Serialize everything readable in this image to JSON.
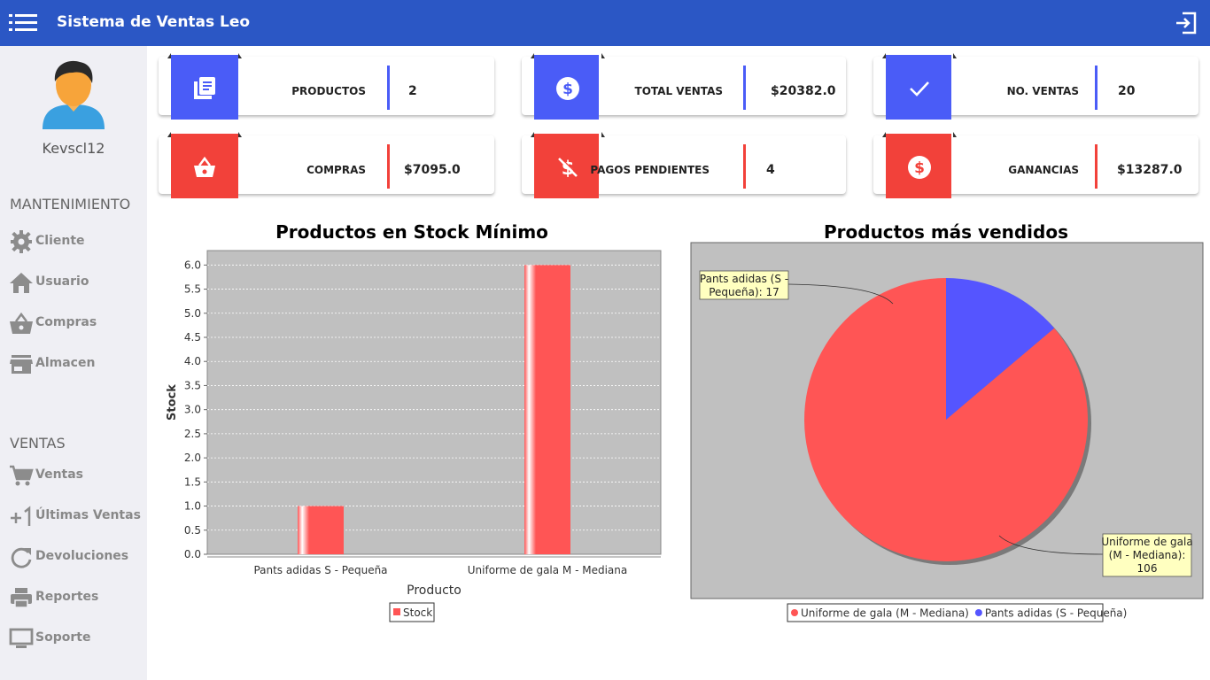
{
  "app": {
    "title": "Sistema de Ventas Leo"
  },
  "user": {
    "name": "Kevscl12"
  },
  "sidebar": {
    "mantenimiento_title": "MANTENIMIENTO",
    "ventas_title": "VENTAS",
    "items": [
      {
        "label": "Cliente",
        "icon": "gear-icon"
      },
      {
        "label": "Usuario",
        "icon": "home-icon"
      },
      {
        "label": "Compras",
        "icon": "basket-icon"
      },
      {
        "label": "Almacen",
        "icon": "store-icon"
      },
      {
        "label": "Ventas",
        "icon": "cart-icon"
      },
      {
        "label": "Últimas Ventas",
        "icon": "plus-one-icon"
      },
      {
        "label": "Devoluciones",
        "icon": "refresh-icon"
      },
      {
        "label": "Reportes",
        "icon": "printer-icon"
      },
      {
        "label": "Soporte",
        "icon": "monitor-icon"
      }
    ]
  },
  "cards": [
    {
      "label": "PRODUCTOS",
      "value": "2",
      "icon": "book-icon",
      "color": "#4a5cf7"
    },
    {
      "label": "TOTAL VENTAS",
      "value": "$20382.0",
      "icon": "dollar-icon",
      "color": "#4a5cf7"
    },
    {
      "label": "NO. VENTAS",
      "value": "20",
      "icon": "check-icon",
      "color": "#4a5cf7"
    },
    {
      "label": "COMPRAS",
      "value": "$7095.0",
      "icon": "basket-icon",
      "color": "#f2413a"
    },
    {
      "label": "PAGOS PENDIENTES",
      "value": "4",
      "icon": "no-dollar-icon",
      "color": "#f2413a"
    },
    {
      "label": "GANANCIAS",
      "value": "$13287.0",
      "icon": "dollar-icon",
      "color": "#f2413a"
    }
  ],
  "chart_data": [
    {
      "type": "bar",
      "title": "Productos en Stock Mínimo",
      "xlabel": "Producto",
      "ylabel": "Stock",
      "categories": [
        "Pants adidas S - Pequeña",
        "Uniforme de gala M - Mediana"
      ],
      "series": [
        {
          "name": "Stock",
          "values": [
            1.0,
            6.0
          ]
        }
      ],
      "ylim": [
        0,
        6.3
      ],
      "yticks": [
        "0.0",
        "0.5",
        "1.0",
        "1.5",
        "2.0",
        "2.5",
        "3.0",
        "3.5",
        "4.0",
        "4.5",
        "5.0",
        "5.5",
        "6.0"
      ],
      "grid": true,
      "legend": "bottom",
      "colors": {
        "bar": "#ff5555",
        "plot_bg": "#c0c0c0"
      }
    },
    {
      "type": "pie",
      "title": "Productos más vendidos",
      "slices": [
        {
          "name": "Uniforme de gala (M - Mediana)",
          "value": 106,
          "label": "Uniforme de gala (M - Mediana): 106",
          "color": "#ff5555"
        },
        {
          "name": "Pants adidas (S - Pequeña)",
          "value": 17,
          "label": "Pants adidas (S - Pequeña): 17",
          "color": "#5555ff"
        }
      ],
      "label_lines": {
        "pants": [
          "Pants adidas (S -",
          "Pequeña): 17"
        ],
        "uniforme": [
          "Uniforme de gala",
          "(M - Mediana):",
          "106"
        ]
      },
      "legend": "bottom",
      "colors": {
        "plot_bg": "#c0c0c0"
      }
    }
  ]
}
